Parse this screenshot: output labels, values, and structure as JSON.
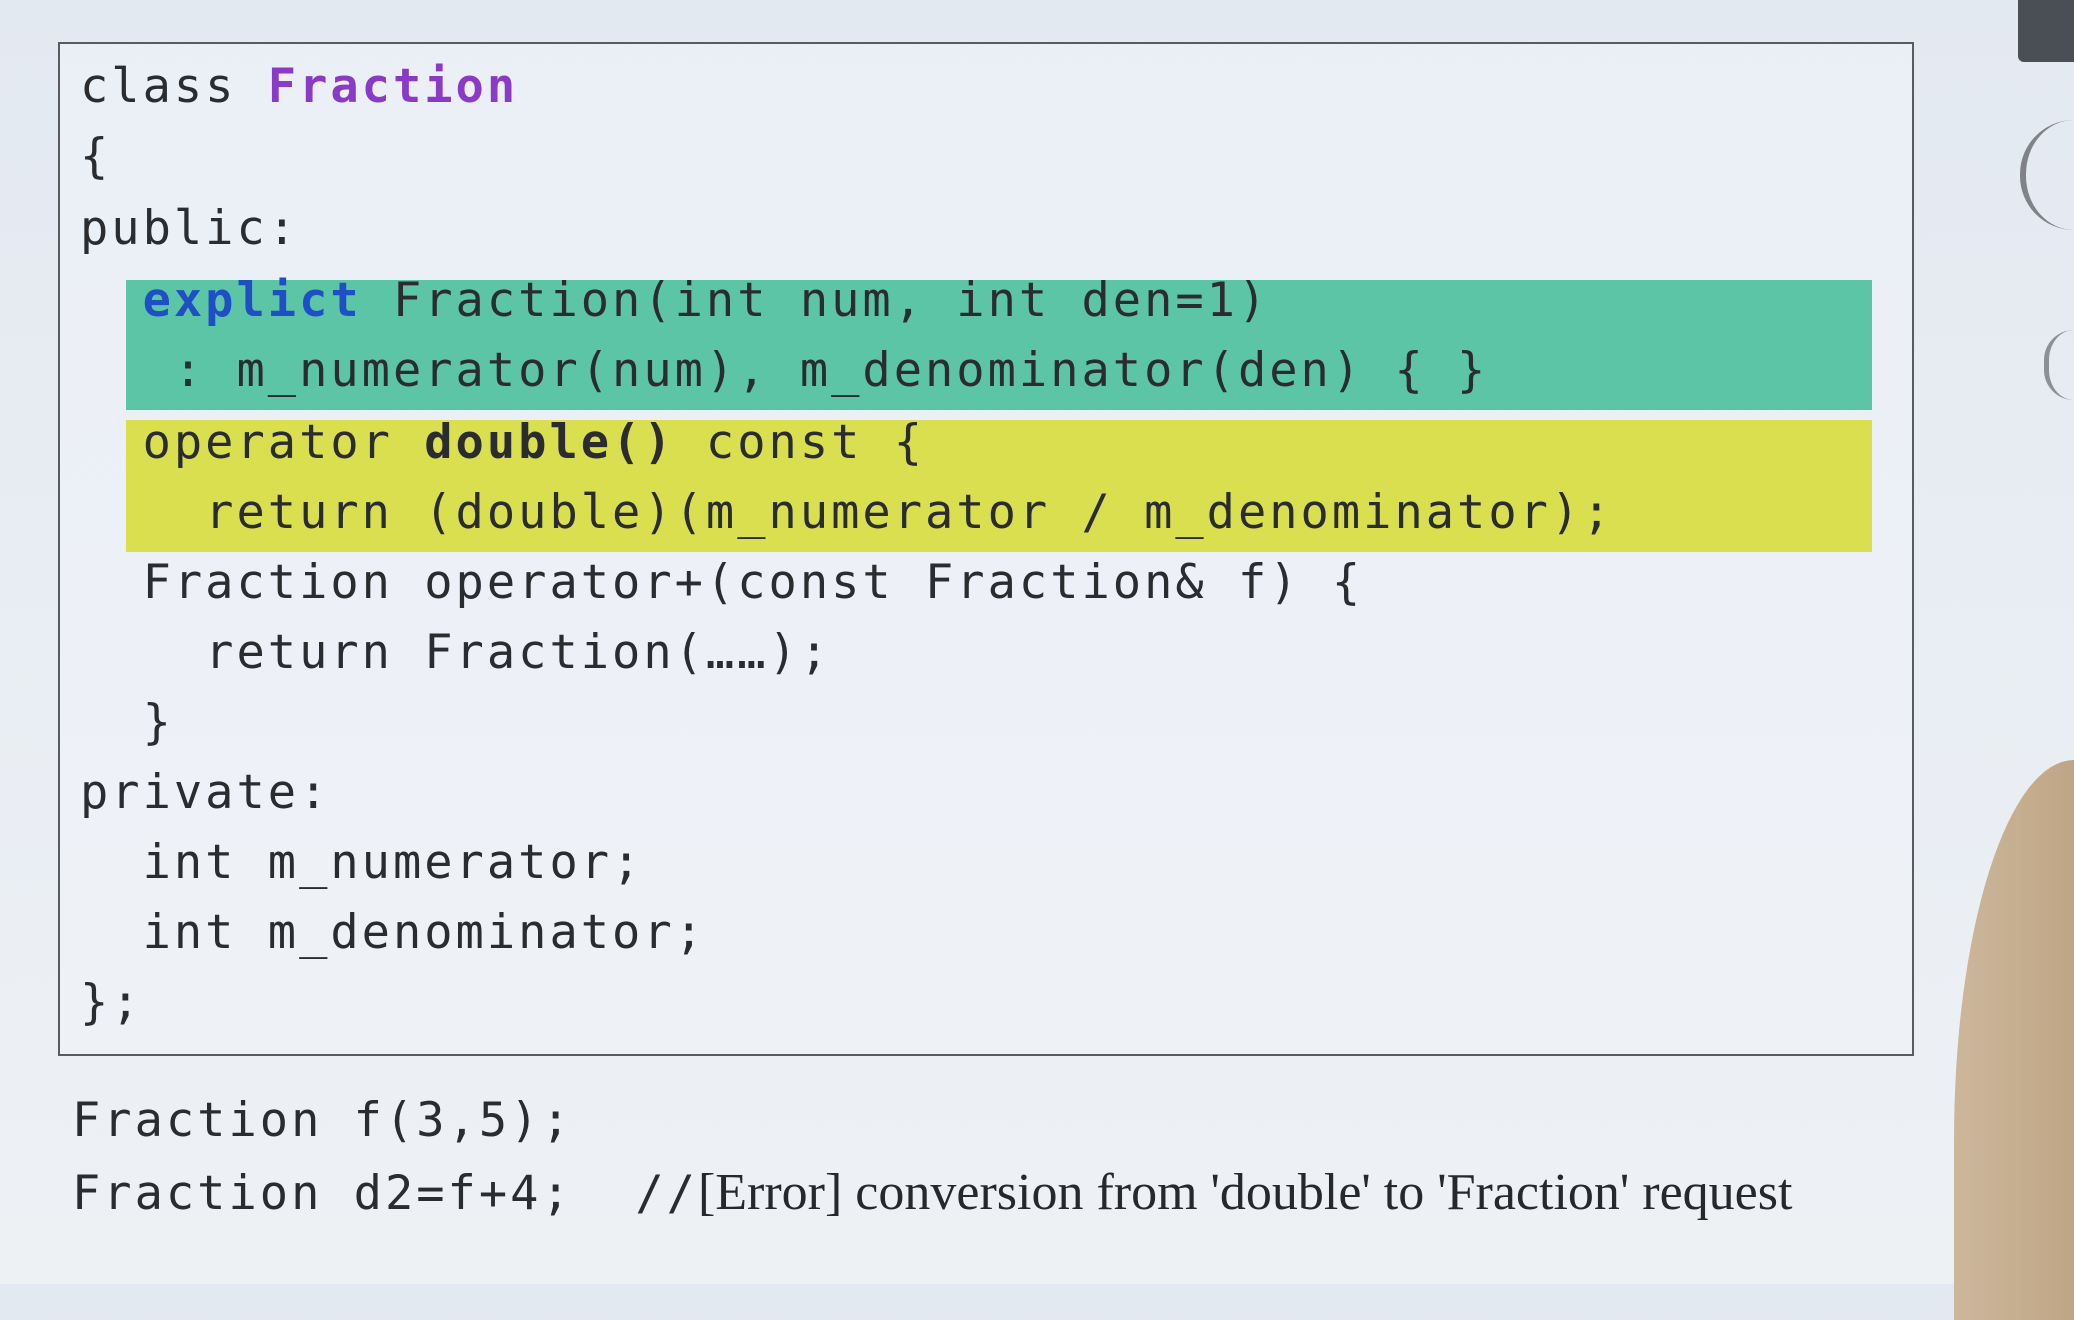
{
  "code_block": {
    "lines": [
      {
        "id": "class_decl",
        "parts": [
          "class ",
          "Fraction"
        ]
      },
      {
        "id": "open_brace",
        "parts": [
          "{"
        ]
      },
      {
        "id": "public_label",
        "parts": [
          "public:"
        ]
      },
      {
        "id": "ctor_sig",
        "parts": [
          "  ",
          "explict",
          " Fraction(int num, int den=1)"
        ]
      },
      {
        "id": "ctor_init",
        "parts": [
          "   : m_numerator(num), m_denominator(den) { }"
        ]
      },
      {
        "id": "conv_sig",
        "parts": [
          "  operator ",
          "double()",
          " const {"
        ]
      },
      {
        "id": "conv_return",
        "parts": [
          "    return (double)(m_numerator / m_denominator);"
        ]
      },
      {
        "id": "plus_sig",
        "parts": [
          "  Fraction operator+(const Fraction& f) {"
        ]
      },
      {
        "id": "plus_return",
        "parts": [
          "    return Fraction(……);"
        ]
      },
      {
        "id": "plus_close",
        "parts": [
          "  }"
        ]
      },
      {
        "id": "private_label",
        "parts": [
          "private:"
        ]
      },
      {
        "id": "member_num",
        "parts": [
          "  int m_numerator;"
        ]
      },
      {
        "id": "member_den",
        "parts": [
          "  int m_denominator;"
        ]
      },
      {
        "id": "close_class",
        "parts": [
          "};"
        ]
      }
    ]
  },
  "usage": {
    "line1": "Fraction f(3,5);",
    "line2_code": "Fraction d2=f+4;  //",
    "line2_error": "[Error]",
    "line2_message": " conversion from 'double' to 'Fraction' request"
  },
  "colors": {
    "keyword_class_name": "#8a3ac6",
    "keyword_explicit": "#1f4fc4",
    "highlight_constructor": "#5cc5a6",
    "highlight_conversion": "#d9df4f",
    "error_text": "#b5292b"
  }
}
